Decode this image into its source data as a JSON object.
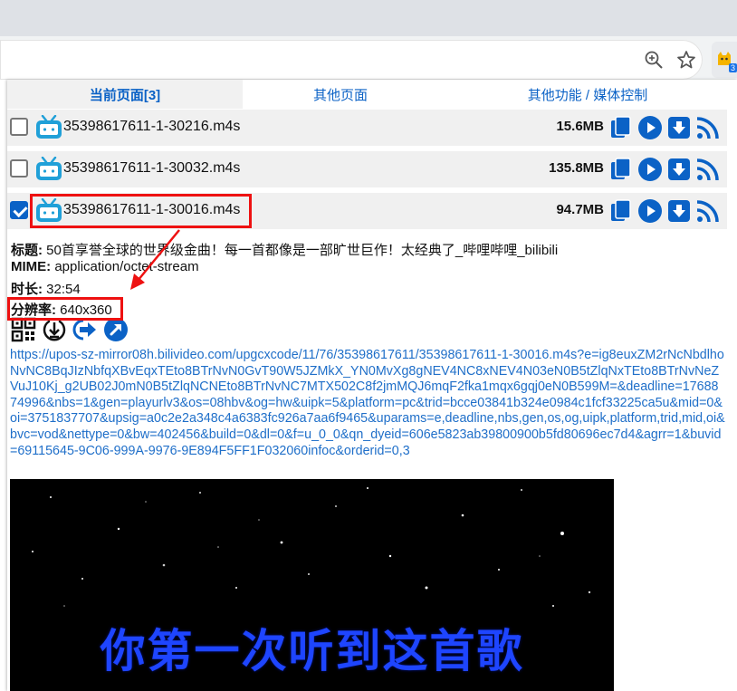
{
  "browser": {
    "zoom_icon": "zoom-icon",
    "star_icon": "bookmark-star-icon",
    "extension_badge": "3"
  },
  "tabs": [
    {
      "label": "当前页面[3]",
      "active": true
    },
    {
      "label": "其他页面",
      "active": false
    },
    {
      "label": "其他功能 / 媒体控制",
      "active": false
    }
  ],
  "files": [
    {
      "name": "35398617611-1-30216.m4s",
      "size": "15.6MB",
      "checked": false
    },
    {
      "name": "35398617611-1-30032.m4s",
      "size": "135.8MB",
      "checked": false
    },
    {
      "name": "35398617611-1-30016.m4s",
      "size": "94.7MB",
      "checked": true
    }
  ],
  "details": {
    "title_label": "标题:",
    "title_value": "50首享誉全球的世界级金曲！每一首都像是一部旷世巨作！太经典了_哔哩哔哩_bilibili",
    "mime_label": "MIME:",
    "mime_value": "application/octet-stream",
    "duration_label": "时长:",
    "duration_value": "32:54",
    "resolution_label": "分辨率:",
    "resolution_value": "640x360"
  },
  "url": "https://upos-sz-mirror08h.bilivideo.com/upgcxcode/11/76/35398617611/35398617611-1-30016.m4s?e=ig8euxZM2rNcNbdlhoNvNC8BqJIzNbfqXBvEqxTEto8BTrNvN0GvT90W5JZMkX_YN0MvXg8gNEV4NC8xNEV4N03eN0B5tZlqNxTEto8BTrNvNeZVuJ10Kj_g2UB02J0mN0B5tZlqNCNEto8BTrNvNC7MTX502C8f2jmMQJ6mqF2fka1mqx6gqj0eN0B599M=&deadline=1768874996&nbs=1&gen=playurlv3&os=08hbv&og=hw&uipk=5&platform=pc&trid=bcce03841b324e0984c1fcf33225ca5u&mid=0&oi=3751837707&upsig=a0c2e2a348c4a6383fc926a7aa6f9465&uparams=e,deadline,nbs,gen,os,og,uipk,platform,trid,mid,oi&bvc=vod&nettype=0&bw=402456&build=0&dl=0&f=u_0_0&qn_dyeid=606e5823ab39800900b5fd80696ec7d4&agrr=1&buvid=69115645-9C06-999A-9976-9E894F5FF1F032060infoc&orderid=0,3",
  "video": {
    "caption": "你第一次听到这首歌"
  },
  "colors": {
    "accent": "#0b62c6",
    "annotation": "#e11111"
  }
}
